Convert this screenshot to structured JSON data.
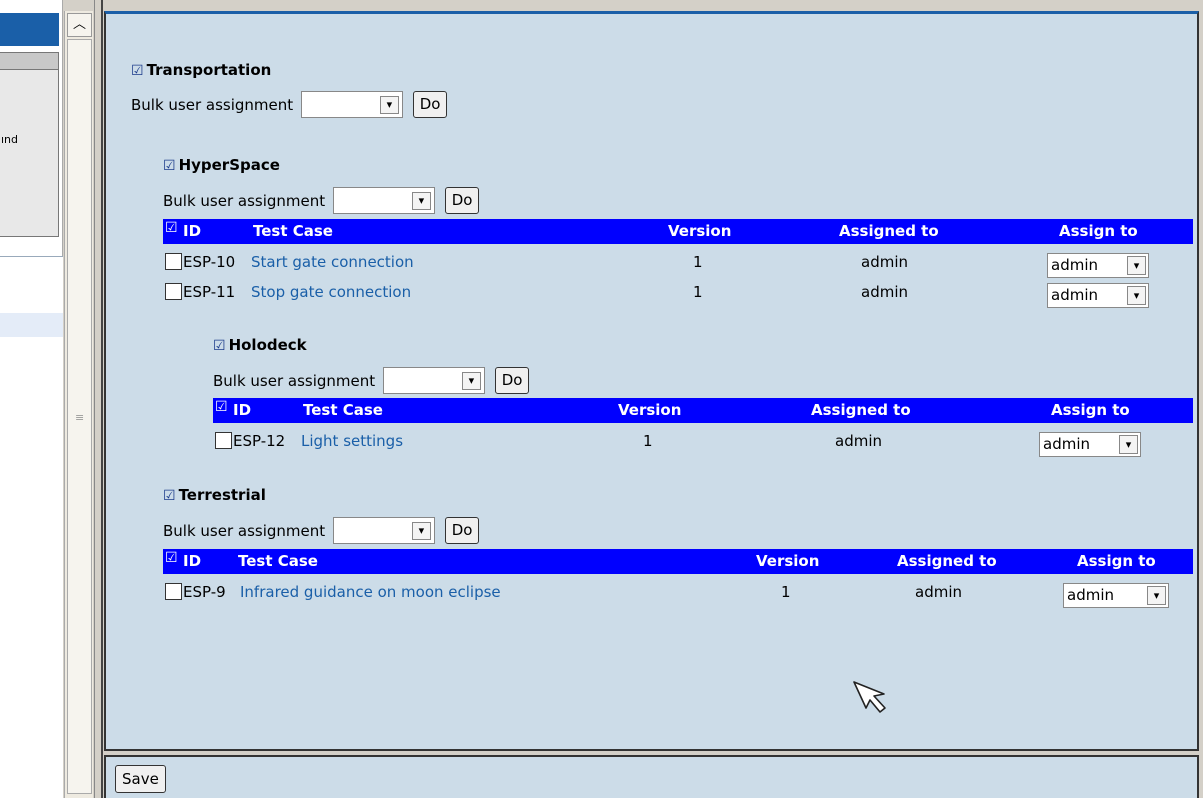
{
  "left_panel": {
    "truncated_text": "ınd"
  },
  "scrollbar": {
    "up_arrow": "︿",
    "grip": "≡"
  },
  "bulk_label": "Bulk user assignment",
  "do_label": "Do",
  "save_label": "Save",
  "dropdown_arrow": "▾",
  "checkmark_glyph": "☑",
  "sections": {
    "transportation": {
      "title": "Transportation"
    },
    "hyperspace": {
      "title": "HyperSpace",
      "columns": {
        "id": "ID",
        "test_case": "Test Case",
        "version": "Version",
        "assigned_to": "Assigned to",
        "assign_to": "Assign to"
      },
      "rows": [
        {
          "id": "ESP-10",
          "test_case": "Start gate connection",
          "version": "1",
          "assigned_to": "admin",
          "assign_to": "admin"
        },
        {
          "id": "ESP-11",
          "test_case": "Stop gate connection",
          "version": "1",
          "assigned_to": "admin",
          "assign_to": "admin"
        }
      ]
    },
    "holodeck": {
      "title": "Holodeck",
      "columns": {
        "id": "ID",
        "test_case": "Test Case",
        "version": "Version",
        "assigned_to": "Assigned to",
        "assign_to": "Assign to"
      },
      "rows": [
        {
          "id": "ESP-12",
          "test_case": "Light settings",
          "version": "1",
          "assigned_to": "admin",
          "assign_to": "admin"
        }
      ]
    },
    "terrestrial": {
      "title": "Terrestrial",
      "columns": {
        "id": "ID",
        "test_case": "Test Case",
        "version": "Version",
        "assigned_to": "Assigned to",
        "assign_to": "Assign to"
      },
      "rows": [
        {
          "id": "ESP-9",
          "test_case": "Infrared guidance on moon eclipse",
          "version": "1",
          "assigned_to": "admin",
          "assign_to": "admin"
        }
      ]
    }
  }
}
